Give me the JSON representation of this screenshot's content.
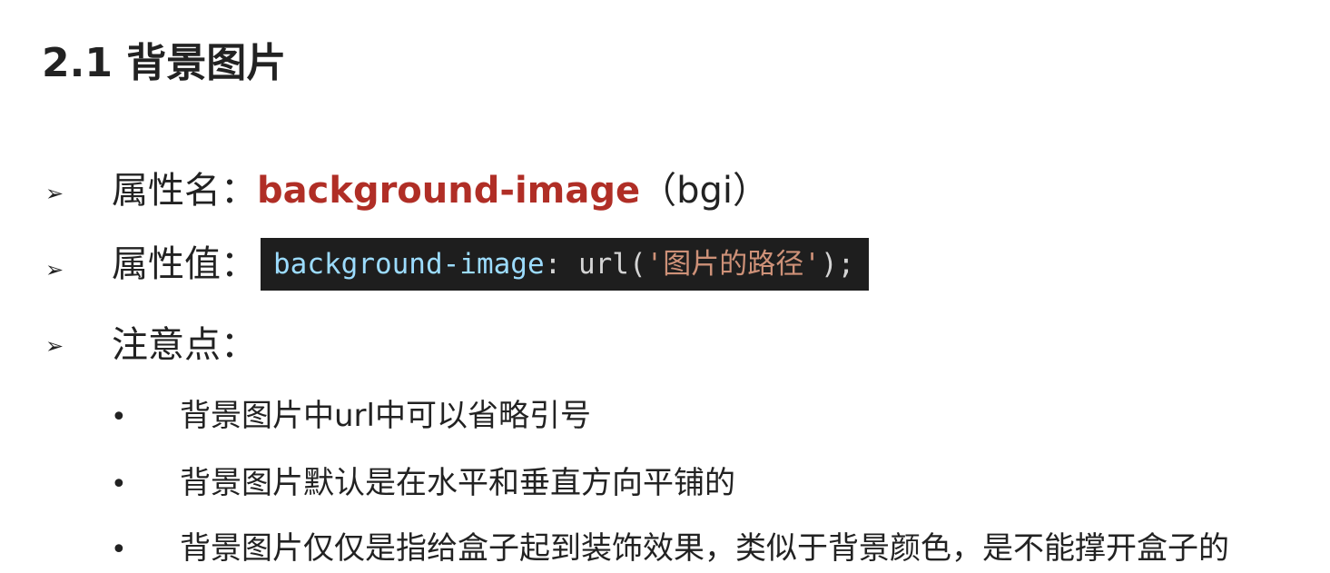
{
  "heading": "2.1 背景图片",
  "items": [
    {
      "label": "属性名：",
      "prop_name": "background-image",
      "suffix": "（bgi）"
    },
    {
      "label": "属性值：",
      "code": {
        "prop": "background-image",
        "colon": ": ",
        "func": "url(",
        "string": "'图片的路径'",
        "end": ");"
      }
    },
    {
      "label": "注意点："
    }
  ],
  "notes": [
    "背景图片中url中可以省略引号",
    "背景图片默认是在水平和垂直方向平铺的",
    "背景图片仅仅是指给盒子起到装饰效果，类似于背景颜色，是不能撑开盒子的"
  ],
  "symbols": {
    "arrow": "➢",
    "bullet": "•"
  },
  "colors": {
    "prop_name": "#b02e26",
    "code_background": "#1e1e1e",
    "code_property": "#9cdcfe",
    "code_string": "#ce9178"
  }
}
